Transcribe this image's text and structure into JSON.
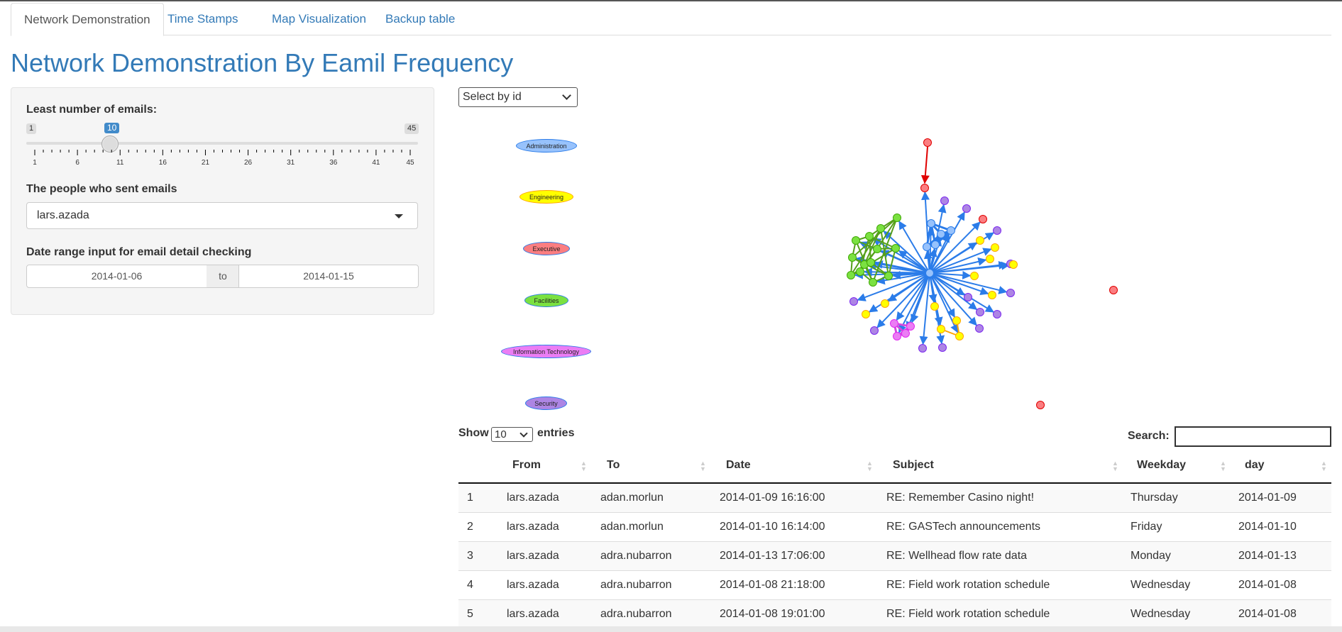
{
  "tabs": [
    {
      "label": "Network Demonstration"
    },
    {
      "label": "Time Stamps"
    },
    {
      "label": "Map Visualization"
    },
    {
      "label": "Backup table"
    }
  ],
  "page_title": "Network Demonstration By Eamil Frequency",
  "sidebar": {
    "slider": {
      "label": "Least number of emails:",
      "min": "1",
      "max": "45",
      "value": "10",
      "ticks": [
        "1",
        "6",
        "11",
        "16",
        "21",
        "26",
        "31",
        "36",
        "41",
        "45"
      ]
    },
    "sender": {
      "label": "The people who sent emails",
      "value": "lars.azada"
    },
    "date_range": {
      "label": "Date range input for email detail checking",
      "start": "2014-01-06",
      "separator": "to",
      "end": "2014-01-15"
    }
  },
  "network": {
    "select_placeholder": "Select by id",
    "legend": [
      {
        "label": "Administration",
        "color": "#97c2fc"
      },
      {
        "label": "Engineering",
        "color": "#ffff00"
      },
      {
        "label": "Executive",
        "color": "#fb7e81"
      },
      {
        "label": "Facilities",
        "color": "#7be141"
      },
      {
        "label": "Information Technology",
        "color": "#eb7df4"
      },
      {
        "label": "Security",
        "color": "#ad85e4"
      }
    ],
    "edge_color": "#2b7ce9"
  },
  "table": {
    "show_label": "Show",
    "length_value": "10",
    "entries_label": "entries",
    "search_label": "Search:",
    "columns": [
      "",
      "From",
      "To",
      "Date",
      "Subject",
      "Weekday",
      "day"
    ],
    "rows": [
      [
        "1",
        "lars.azada",
        "adan.morlun",
        "2014-01-09 16:16:00",
        "RE: Remember Casino night!",
        "Thursday",
        "2014-01-09"
      ],
      [
        "2",
        "lars.azada",
        "adan.morlun",
        "2014-01-10 16:14:00",
        "RE: GASTech announcements",
        "Friday",
        "2014-01-10"
      ],
      [
        "3",
        "lars.azada",
        "adra.nubarron",
        "2014-01-13 17:06:00",
        "RE: Wellhead flow rate data",
        "Monday",
        "2014-01-13"
      ],
      [
        "4",
        "lars.azada",
        "adra.nubarron",
        "2014-01-08 21:18:00",
        "RE: Field work rotation schedule",
        "Wednesday",
        "2014-01-08"
      ],
      [
        "5",
        "lars.azada",
        "adra.nubarron",
        "2014-01-08 19:01:00",
        "RE: Field work rotation schedule",
        "Wednesday",
        "2014-01-08"
      ]
    ]
  }
}
